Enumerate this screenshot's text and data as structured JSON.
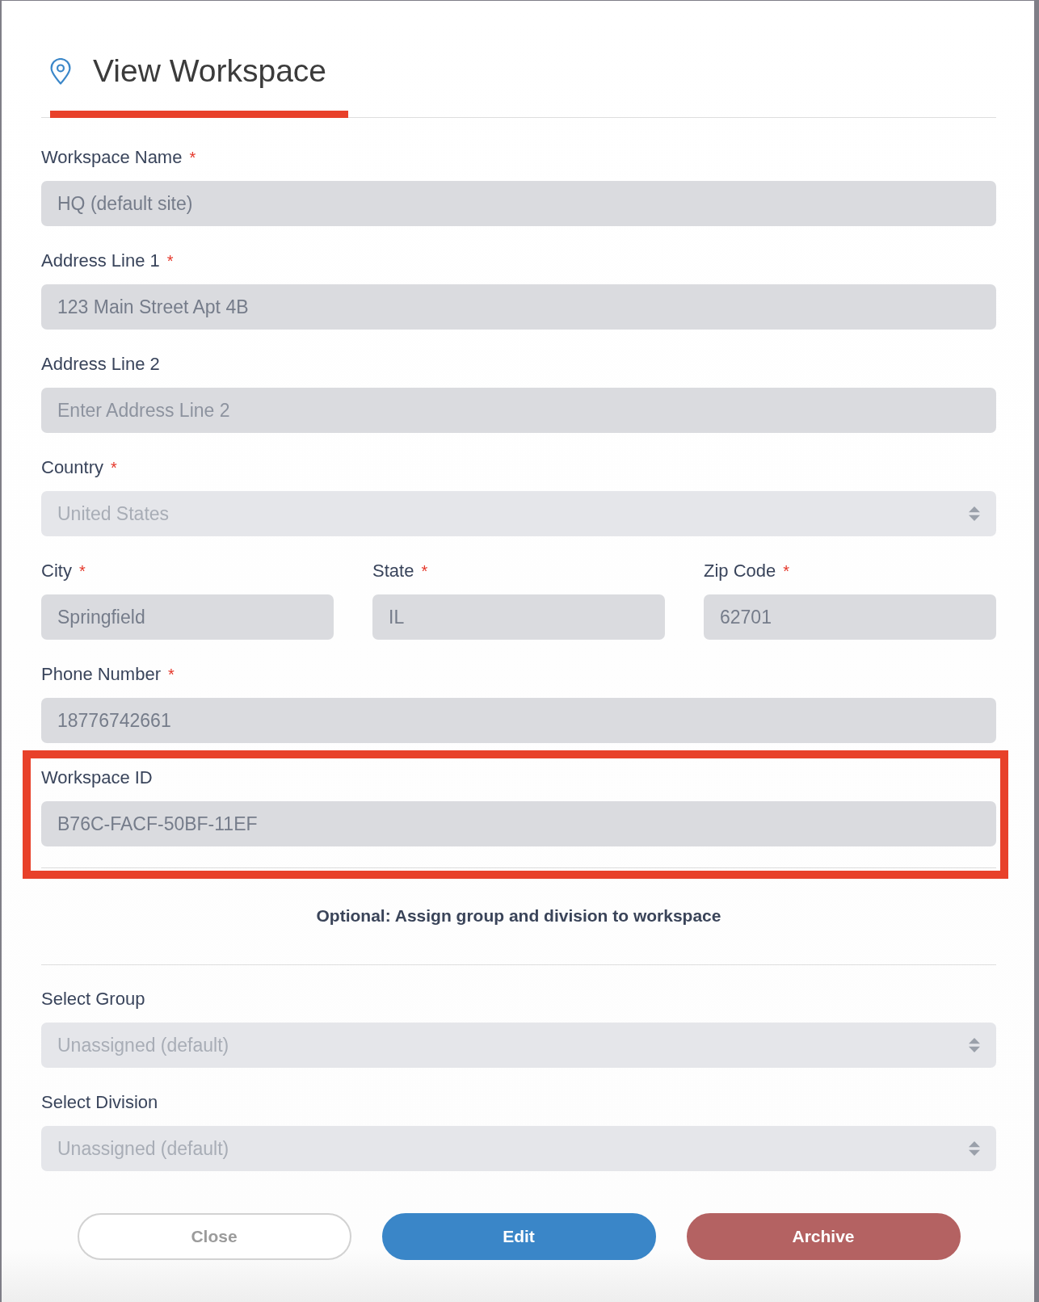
{
  "title": {
    "text": "View Workspace"
  },
  "fields": [
    {
      "kind": "text",
      "label": "Workspace Name",
      "required_mark": "*",
      "value": "HQ (default site)",
      "disabled": true
    },
    {
      "kind": "text",
      "label": "Address Line 1",
      "required_mark": "*",
      "value": "123 Main Street Apt 4B",
      "disabled": true
    },
    {
      "kind": "text",
      "label": "Address Line 2",
      "placeholder": "Enter Address Line 2",
      "disabled": true
    },
    {
      "kind": "select",
      "label": "Country",
      "required_mark": "*",
      "value": "United States",
      "disabled": true
    },
    {
      "kind": "row",
      "fields": [
        {
          "kind": "text",
          "label": "City",
          "required_mark": "*",
          "value": "Springfield",
          "disabled": true
        },
        {
          "kind": "text",
          "label": "State",
          "required_mark": "*",
          "value": "IL",
          "disabled": true
        },
        {
          "kind": "text",
          "label": "Zip Code",
          "required_mark": "*",
          "value": "62701",
          "disabled": true
        }
      ]
    },
    {
      "kind": "text",
      "label": "Phone Number",
      "required_mark": "*",
      "value": "18776742661",
      "disabled": true
    }
  ],
  "workspace_id": {
    "kind": "text",
    "label": "Workspace ID",
    "value": "B76C-FACF-50BF-11EF",
    "disabled": true,
    "highlighted": true
  },
  "optional_section": {
    "heading": "Optional: Assign group and division to workspace",
    "fields": [
      {
        "kind": "select",
        "label": "Select Group",
        "value": "Unassigned (default)",
        "disabled": true
      },
      {
        "kind": "select",
        "label": "Select Division",
        "value": "Unassigned (default)",
        "disabled": true
      }
    ]
  },
  "buttons": [
    {
      "kind": "close",
      "label": "Close"
    },
    {
      "kind": "edit",
      "label": "Edit"
    },
    {
      "kind": "archive",
      "label": "Archive"
    }
  ]
}
